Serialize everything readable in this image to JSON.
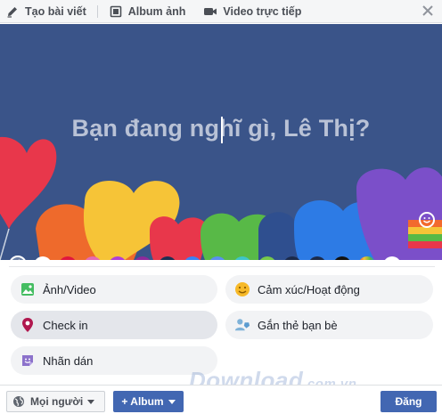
{
  "tabs": [
    {
      "label": "Tạo bài viết",
      "icon": "pencil-icon"
    },
    {
      "label": "Album ảnh",
      "icon": "photo-album-icon"
    },
    {
      "label": "Video trực tiếp",
      "icon": "video-camera-icon"
    }
  ],
  "composer": {
    "prompt": "Bạn đang nghĩ gì, Lê Thị?",
    "background_color": "#3a5489"
  },
  "swatches": [
    {
      "color": "#ffffff",
      "selected": false
    },
    {
      "color": "#e0163e",
      "selected": false
    },
    {
      "color": "#e46ab4",
      "selected": false
    },
    {
      "color": "#b03fd6",
      "selected": false
    },
    {
      "color": "#8e2a9c",
      "selected": false
    },
    {
      "color": "#1e2f52",
      "selected": false
    },
    {
      "color": "#3b82f6",
      "selected": false
    },
    {
      "color": "#5a8ff0",
      "selected": false
    },
    {
      "color": "#3ec5c8",
      "selected": false
    },
    {
      "color": "#77c84a",
      "selected": false
    },
    {
      "color": "#1b2a4a",
      "selected": false
    },
    {
      "color": "#1c2b4a",
      "selected": false
    },
    {
      "color": "#111111",
      "selected": false
    },
    {
      "color": "#f5a623",
      "selected": false
    },
    {
      "color": "#ffffff",
      "selected": true
    }
  ],
  "options": [
    {
      "label": "Ảnh/Video",
      "icon": "photo-icon"
    },
    {
      "label": "Cảm xúc/Hoạt động",
      "icon": "smiley-icon"
    },
    {
      "label": "Check in",
      "icon": "location-pin-icon"
    },
    {
      "label": "Gắn thẻ bạn bè",
      "icon": "tag-friends-icon"
    },
    {
      "label": "Nhãn dán",
      "icon": "sticker-icon"
    }
  ],
  "footer": {
    "audience": "Mọi người",
    "album": "+ Album",
    "post": "Đăng"
  },
  "watermark": {
    "text": "Download",
    "suffix": ".com.vn"
  },
  "watermark_dots": [
    "#a9d4f5",
    "#f7c6c6",
    "#c6e6b5",
    "#f9e08e",
    "#a9c6f5"
  ],
  "colors": {
    "accent": "#4267b2",
    "banner": "#3a5489"
  }
}
